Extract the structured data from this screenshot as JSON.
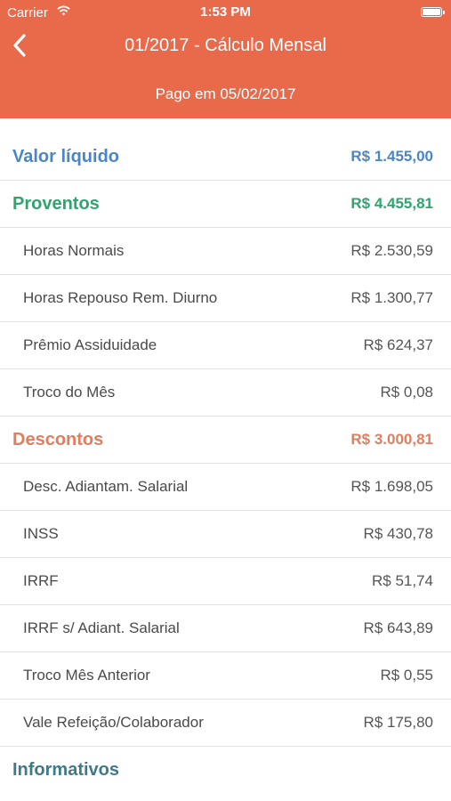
{
  "status_bar": {
    "carrier": "Carrier",
    "time": "1:53 PM"
  },
  "header": {
    "title": "01/2017 - Cálculo Mensal",
    "subtitle": "Pago em 05/02/2017"
  },
  "colors": {
    "header_bg": "#e9694b",
    "valor_liquido": "#4a86c6",
    "proventos": "#2ea56d",
    "descontos": "#e27d5e",
    "informativos": "#3f7a86"
  },
  "valor_liquido": {
    "label": "Valor líquido",
    "value": "R$ 1.455,00"
  },
  "proventos": {
    "label": "Proventos",
    "value": "R$ 4.455,81",
    "items": [
      {
        "label": "Horas Normais",
        "value": "R$ 2.530,59"
      },
      {
        "label": "Horas Repouso Rem. Diurno",
        "value": "R$ 1.300,77"
      },
      {
        "label": "Prêmio Assiduidade",
        "value": "R$ 624,37"
      },
      {
        "label": "Troco do Mês",
        "value": "R$ 0,08"
      }
    ]
  },
  "descontos": {
    "label": "Descontos",
    "value": "R$ 3.000,81",
    "items": [
      {
        "label": "Desc. Adiantam. Salarial",
        "value": "R$ 1.698,05"
      },
      {
        "label": "INSS",
        "value": "R$ 430,78"
      },
      {
        "label": "IRRF",
        "value": "R$ 51,74"
      },
      {
        "label": "IRRF s/ Adiant. Salarial",
        "value": "R$ 643,89"
      },
      {
        "label": "Troco Mês Anterior",
        "value": "R$ 0,55"
      },
      {
        "label": "Vale Refeição/Colaborador",
        "value": "R$ 175,80"
      }
    ]
  },
  "informativos": {
    "label": "Informativos"
  }
}
